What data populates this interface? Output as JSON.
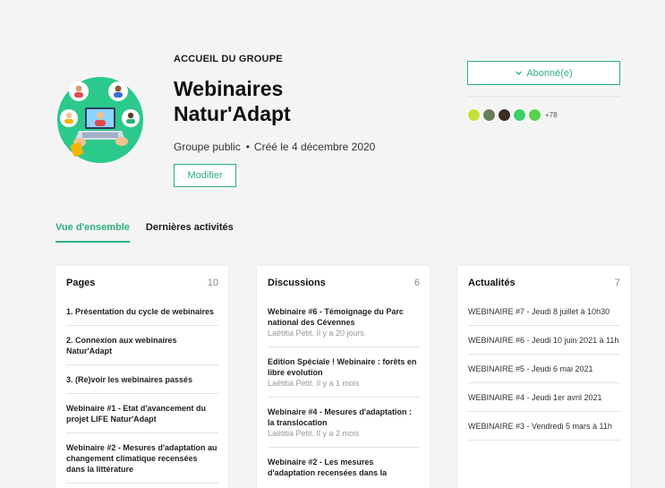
{
  "header": {
    "eyebrow": "ACCUEIL DU GROUPE",
    "title": "Webinaires Natur'Adapt",
    "visibility": "Groupe public",
    "created": "Créé le 4 décembre 2020",
    "edit_label": "Modifier",
    "subscribe_label": "Abonné(e)",
    "members_more": "+78",
    "member_colors": [
      "#c8e03a",
      "#6a7d5a",
      "#3c2e26",
      "#3bd16a",
      "#56d24e"
    ]
  },
  "tabs": [
    {
      "label": "Vue d'ensemble",
      "active": true
    },
    {
      "label": "Dernières activités",
      "active": false
    }
  ],
  "cards": {
    "pages": {
      "title": "Pages",
      "count": "10",
      "items": [
        {
          "title": "1. Présentation du cycle de webinaires"
        },
        {
          "title": "2. Connexion aux webinaires Natur'Adapt"
        },
        {
          "title": "3. (Re)voir les webinaires passés"
        },
        {
          "title": "Webinaire #1 - Etat d'avancement du projet LIFE Natur'Adapt"
        },
        {
          "title": "Webinaire #2 - Mesures d'adaptation au changement climatique recensées dans la littérature"
        }
      ]
    },
    "discussions": {
      "title": "Discussions",
      "count": "6",
      "items": [
        {
          "title": "Webinaire #6 - Témoignage du Parc national des Cévennes",
          "sub": "Laëtitia Petit. Il y a 20 jours"
        },
        {
          "title": "Edition Spéciale ! Webinaire : forêts en libre evolution",
          "sub": "Laëtitia Petit. Il y a 1 mois"
        },
        {
          "title": "Webinaire #4 - Mesures d'adaptation : la translocation",
          "sub": "Laëtitia Petit. Il y a 2 mois"
        },
        {
          "title": "Webinaire #2 - Les mesures d'adaptation recensées dans la",
          "sub": ""
        }
      ]
    },
    "news": {
      "title": "Actualités",
      "count": "7",
      "items": [
        {
          "title": "WEBINAIRE #7 - Jeudi 8 juillet à 10h30"
        },
        {
          "title": "WEBINAIRE #6 - Jeudi 10 juin 2021 à 11h"
        },
        {
          "title": "WEBINAIRE #5 - Jeudi 6 mai 2021"
        },
        {
          "title": "WEBINAIRE #4 - Jeudi 1er avril 2021"
        },
        {
          "title": "WEBINAIRE #3 - Vendredi 5 mars à 11h"
        }
      ]
    }
  }
}
